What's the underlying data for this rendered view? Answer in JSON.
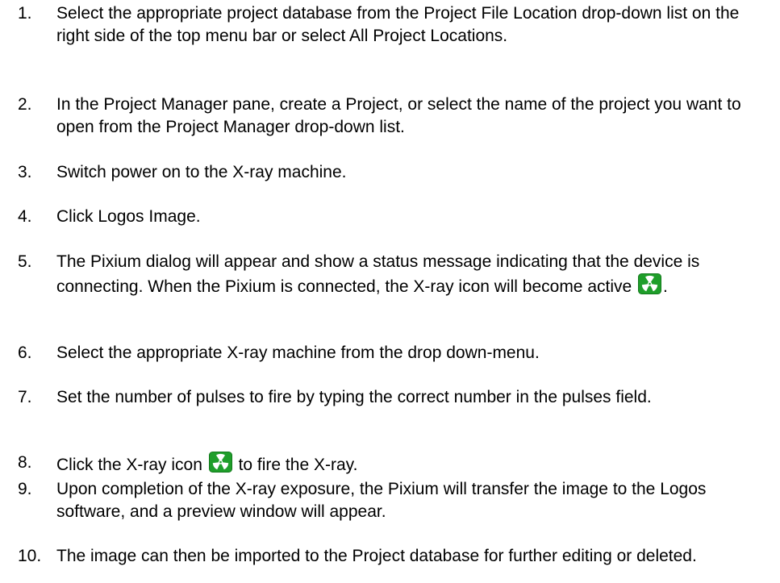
{
  "steps": [
    {
      "number": "1.",
      "text": "Select the appropriate project database from the Project File Location drop-down list on the right side of the top menu bar or select All Project Locations."
    },
    {
      "number": "2.",
      "text": "In the Project Manager pane, create a Project, or select the name of the project you want to open from the Project Manager drop-down list."
    },
    {
      "number": "3.",
      "text": "Switch power on to the X-ray machine."
    },
    {
      "number": "4.",
      "text": "Click Logos Image."
    },
    {
      "number": "5.",
      "text_before_icon": "The Pixium dialog will appear and show a status message indicating that the device is connecting. When the Pixium is connected, the X-ray icon will become active",
      "text_after_icon": ".",
      "icon": "xray-icon"
    },
    {
      "number": "6.",
      "text": "Select the appropriate X-ray machine from the drop down-menu."
    },
    {
      "number": "7.",
      "text": "Set the number of pulses to fire by typing the correct number in the pulses field."
    },
    {
      "number": "8.",
      "text_before_icon": "Click the X-ray icon",
      "text_after_icon": "to fire the X-ray.",
      "icon": "xray-icon"
    },
    {
      "number": "9.",
      "text": "Upon completion of the X-ray exposure, the Pixium will transfer the image to the Logos software, and a preview window will appear."
    },
    {
      "number": "10.",
      "text": "The image can then be imported to the Project database for further editing or deleted."
    }
  ],
  "colors": {
    "text": "#000000",
    "icon_green": "#1f9e2a",
    "icon_symbol": "#ffffff"
  }
}
